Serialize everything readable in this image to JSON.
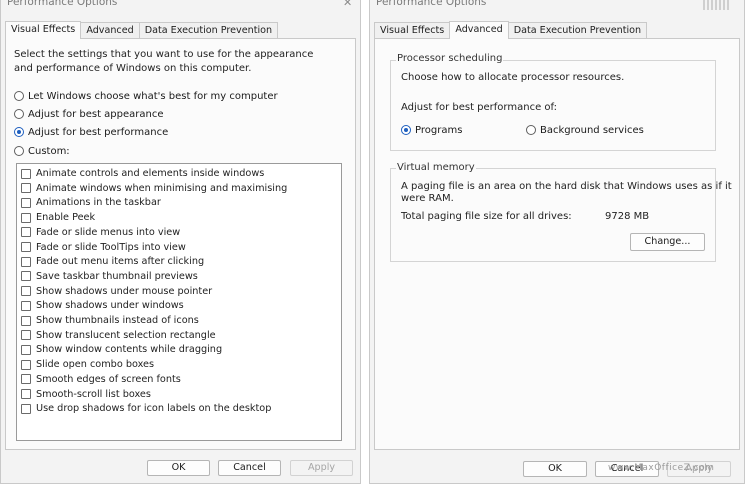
{
  "left_window": {
    "title": "Performance Options",
    "close_glyph": "✕",
    "tabs": [
      {
        "label": "Visual Effects",
        "active": true
      },
      {
        "label": "Advanced",
        "active": false
      },
      {
        "label": "Data Execution Prevention",
        "active": false
      }
    ],
    "description": "Select the settings that you want to use for the appearance and performance of Windows on this computer.",
    "radios": [
      {
        "label": "Let Windows choose what's best for my computer",
        "selected": false
      },
      {
        "label": "Adjust for best appearance",
        "selected": false
      },
      {
        "label": "Adjust for best performance",
        "selected": true
      },
      {
        "label": "Custom:",
        "selected": false
      }
    ],
    "effects": [
      "Animate controls and elements inside windows",
      "Animate windows when minimising and maximising",
      "Animations in the taskbar",
      "Enable Peek",
      "Fade or slide menus into view",
      "Fade or slide ToolTips into view",
      "Fade out menu items after clicking",
      "Save taskbar thumbnail previews",
      "Show shadows under mouse pointer",
      "Show shadows under windows",
      "Show thumbnails instead of icons",
      "Show translucent selection rectangle",
      "Show window contents while dragging",
      "Slide open combo boxes",
      "Smooth edges of screen fonts",
      "Smooth-scroll list boxes",
      "Use drop shadows for icon labels on the desktop"
    ],
    "buttons": {
      "ok": "OK",
      "cancel": "Cancel",
      "apply": "Apply"
    }
  },
  "right_window": {
    "title": "Performance Options",
    "tabs": [
      {
        "label": "Visual Effects",
        "active": false
      },
      {
        "label": "Advanced",
        "active": true
      },
      {
        "label": "Data Execution Prevention",
        "active": false
      }
    ],
    "processor_scheduling": {
      "title": "Processor scheduling",
      "description": "Choose how to allocate processor resources.",
      "adjust_label": "Adjust for best performance of:",
      "programs": "Programs",
      "background": "Background services",
      "selected": "programs"
    },
    "virtual_memory": {
      "title": "Virtual memory",
      "description_line1": "A paging file is an area on the hard disk that Windows uses as if it",
      "description_line2": "were RAM.",
      "total_label": "Total paging file size for all drives:",
      "total_value": "9728 MB",
      "change_button": "Change..."
    },
    "buttons": {
      "ok": "OK",
      "cancel": "Cancel",
      "apply": "Apply"
    }
  },
  "watermark": "www.MaxOfficeZ.com"
}
